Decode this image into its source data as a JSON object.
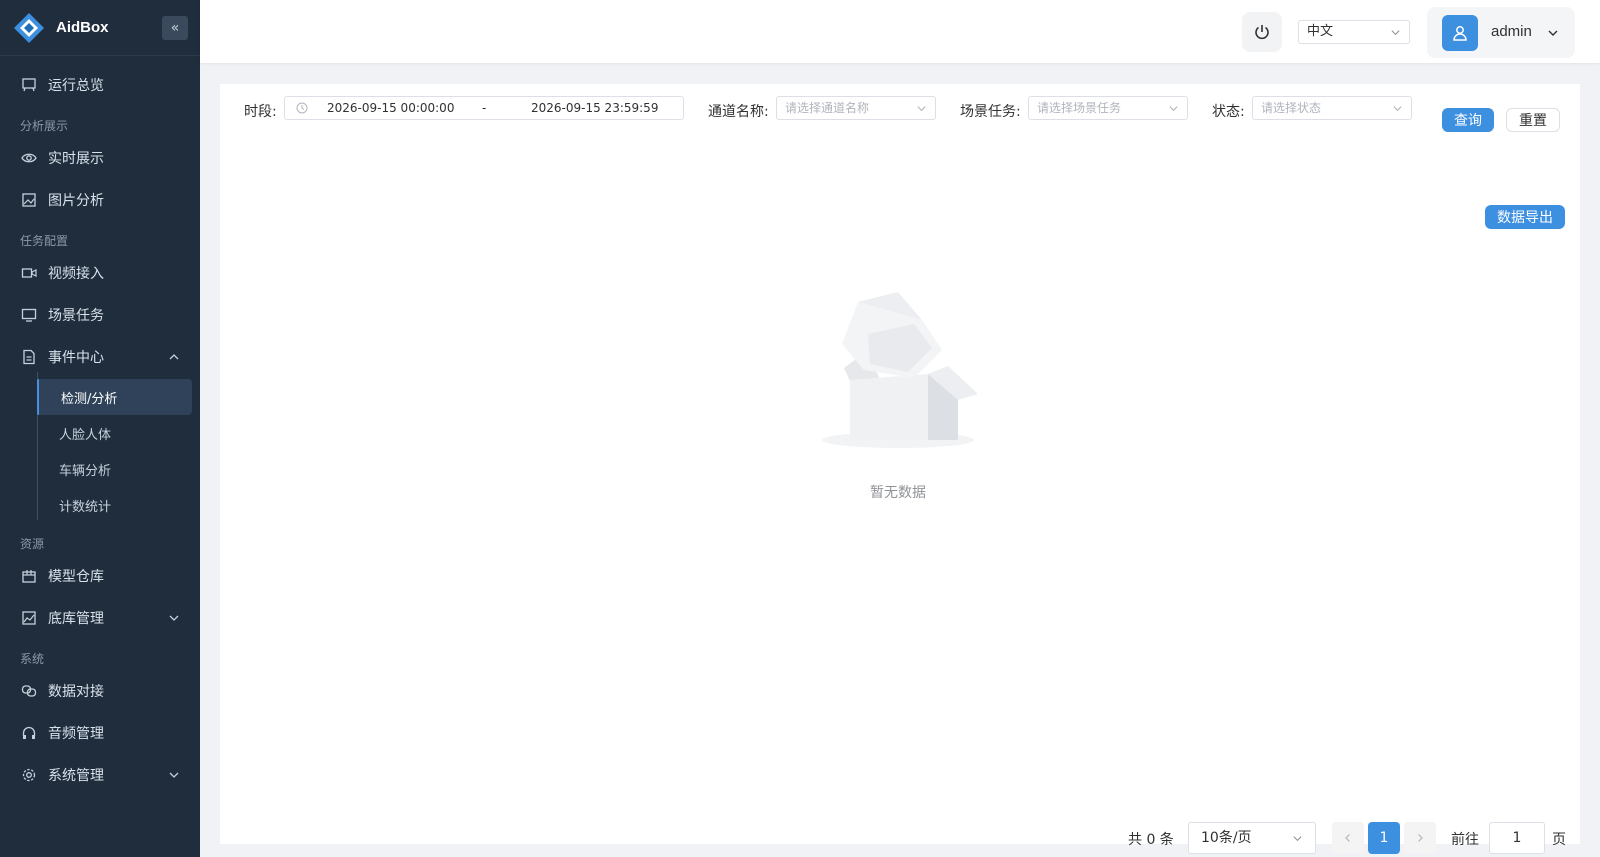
{
  "sidebar": {
    "brand": "AidBox",
    "collapse_icon": "double-chevron-left-icon",
    "items": [
      {
        "label": "运行总览",
        "icon": "flag-icon"
      },
      {
        "label": "实时展示",
        "icon": "eye-icon"
      },
      {
        "label": "图片分析",
        "icon": "image-icon"
      },
      {
        "label": "视频接入",
        "icon": "video-icon"
      },
      {
        "label": "场景任务",
        "icon": "monitor-icon"
      },
      {
        "label": "事件中心",
        "icon": "document-icon",
        "expanded": true
      },
      {
        "label": "模型仓库",
        "icon": "package-icon"
      },
      {
        "label": "底库管理",
        "icon": "picture-icon"
      },
      {
        "label": "数据对接",
        "icon": "link-icon"
      },
      {
        "label": "音频管理",
        "icon": "headphones-icon"
      },
      {
        "label": "系统管理",
        "icon": "gear-icon"
      }
    ],
    "sections": {
      "analysis": "分析展示",
      "task": "任务配置",
      "resource": "资源",
      "system": "系统"
    },
    "event_sub": [
      "检测/分析",
      "人脸人体",
      "车辆分析",
      "计数统计"
    ],
    "active_sub": "检测/分析"
  },
  "header": {
    "language": "中文",
    "user": "admin"
  },
  "filters": {
    "period_label": "时段:",
    "date_start": "2026-09-15 00:00:00",
    "date_sep": "-",
    "date_end": "2026-09-15 23:59:59",
    "channel_label": "通道名称:",
    "channel_placeholder": "请选择通道名称",
    "scene_label": "场景任务:",
    "scene_placeholder": "请选择场景任务",
    "status_label": "状态:",
    "status_placeholder": "请选择状态",
    "query": "查询",
    "reset": "重置",
    "export": "数据导出"
  },
  "empty_text": "暂无数据",
  "pagination": {
    "total": "共 0 条",
    "page_size": "10条/页",
    "current_page": "1",
    "goto_label": "前往",
    "goto_value": "1",
    "page_unit": "页"
  },
  "colors": {
    "sidebar_bg": "#1f2d3d",
    "accent": "#3d8fe0"
  }
}
